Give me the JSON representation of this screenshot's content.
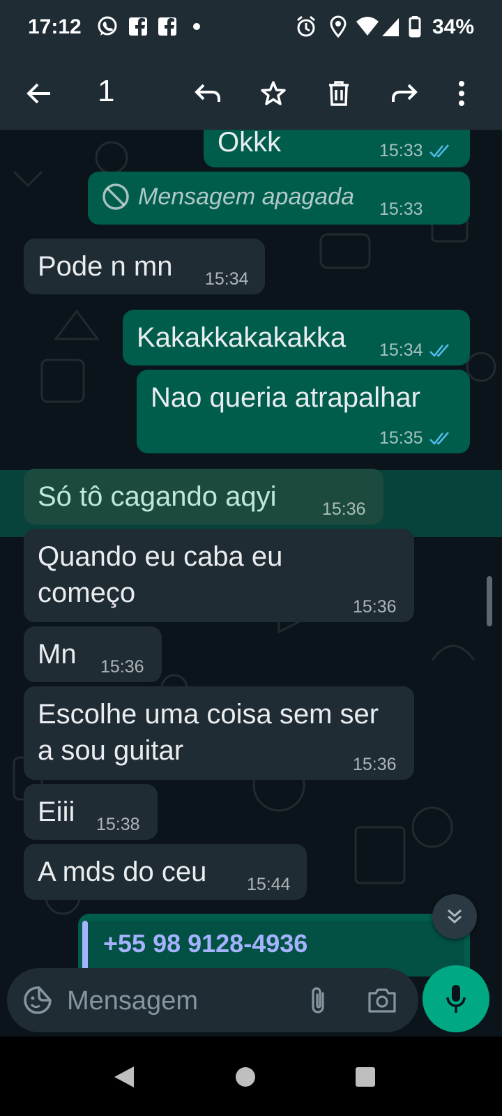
{
  "status_bar": {
    "time": "17:12",
    "battery": "34%",
    "icons": [
      "whatsapp-icon",
      "facebook-icon",
      "facebook-icon",
      "dot-icon",
      "alarm-icon",
      "location-icon",
      "wifi-icon",
      "signal-icon",
      "battery-icon"
    ]
  },
  "toolbar": {
    "selected_count": "1",
    "actions": [
      "back-icon",
      "reply-icon",
      "star-icon",
      "delete-icon",
      "forward-icon",
      "more-icon"
    ]
  },
  "messages": [
    {
      "dir": "out",
      "text": "Okkk",
      "time": "15:33",
      "ticks": "read"
    },
    {
      "dir": "out",
      "text": "Mensagem apagada",
      "time": "15:33",
      "deleted": true
    },
    {
      "dir": "in",
      "text": "Pode n mn",
      "time": "15:34"
    },
    {
      "dir": "out",
      "text": "Kakakkakakakka",
      "time": "15:34",
      "ticks": "read"
    },
    {
      "dir": "out",
      "text": "Nao queria atrapalhar",
      "time": "15:35",
      "ticks": "read"
    },
    {
      "dir": "in",
      "text": "Só tô cagando aqyi",
      "time": "15:36",
      "selected": true
    },
    {
      "dir": "in",
      "text": "Quando eu caba eu começo",
      "time": "15:36"
    },
    {
      "dir": "in",
      "text": "Mn",
      "time": "15:36"
    },
    {
      "dir": "in",
      "text": "Escolhe uma coisa sem ser a sou guitar",
      "time": "15:36"
    },
    {
      "dir": "in",
      "text": "Eiii",
      "time": "15:38"
    },
    {
      "dir": "in",
      "text": "A mds do ceu",
      "time": "15:44"
    }
  ],
  "quoted_contact": "+55 98 9128-4936",
  "input": {
    "placeholder": "Mensagem"
  },
  "colors": {
    "outgoing_bubble": "#005c4b",
    "incoming_bubble": "#202c33",
    "background": "#0b141a",
    "accent": "#00a884",
    "read_ticks": "#53bdeb"
  }
}
